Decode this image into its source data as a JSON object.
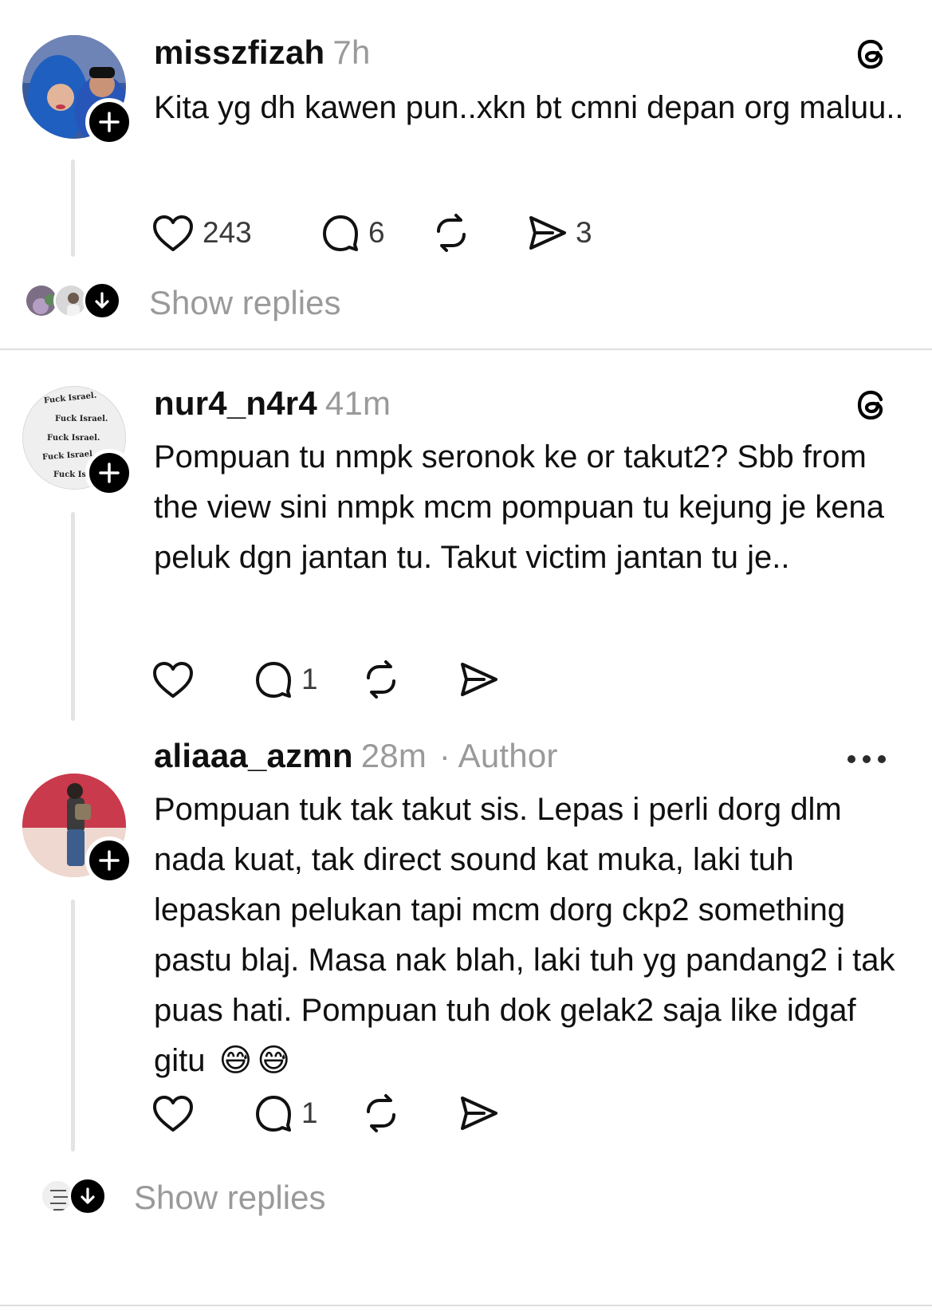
{
  "posts": [
    {
      "username": "misszfizah",
      "time": "7h",
      "text": "Kita yg dh kawen pun..xkn bt cmni depan org maluu..",
      "actions": {
        "likes": "243",
        "comments": "6",
        "reposts": "",
        "shares": "3"
      },
      "top_icon": "threads-logo-icon"
    },
    {
      "username": "nur4_n4r4",
      "time": "41m",
      "text": "Pompuan tu nmpk seronok ke or takut2? Sbb from the view sini nmpk mcm pompuan tu kejung je kena peluk dgn jantan tu. Takut victim jantan tu je..",
      "actions": {
        "likes": "",
        "comments": "1",
        "reposts": "",
        "shares": ""
      },
      "top_icon": "threads-logo-icon"
    },
    {
      "username": "aliaaa_azmn",
      "time": "28m",
      "author_badge": "· Author",
      "text": "Pompuan tuk tak takut sis. Lepas i perli dorg dlm nada kuat, tak direct sound kat muka, laki tuh lepaskan pelukan tapi mcm dorg ckp2 something pastu blaj. Masa nak blah, laki tuh yg pandang2 i tak puas hati. Pompuan tuh dok gelak2 saja like idgaf gitu",
      "emojis": [
        "😅",
        "😅"
      ],
      "actions": {
        "likes": "",
        "comments": "1",
        "reposts": "",
        "shares": ""
      },
      "top_icon": "more-icon"
    }
  ],
  "avatar_text": {
    "nur4_n4r4": [
      "Fuck Israel.",
      "Fuck Israel.",
      "Fuck Israel.",
      "Fuck Israel.",
      "Fuck Is"
    ]
  },
  "show_replies": [
    "Show replies",
    "Show replies"
  ],
  "colors": {
    "meta": "#9a9a9a",
    "divider": "#dedede",
    "thread_line": "#e3e3e3"
  }
}
